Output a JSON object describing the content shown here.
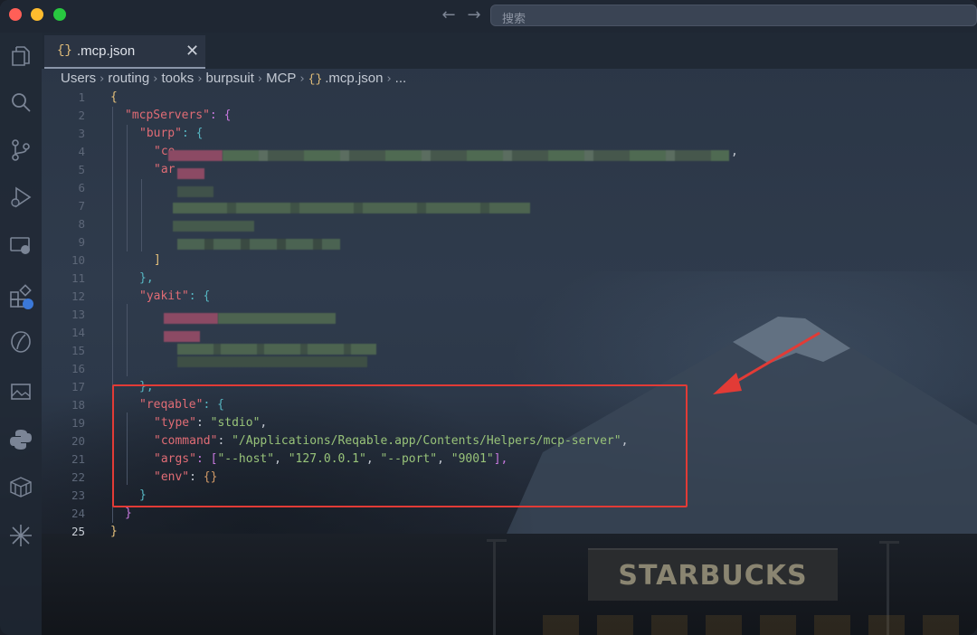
{
  "window": {
    "search_placeholder": "搜索"
  },
  "tab": {
    "braces": "{}",
    "filename": ".mcp.json",
    "close": "✕"
  },
  "breadcrumb": {
    "parts": [
      "Users",
      "routing",
      "tooks",
      "burpsuit",
      "MCP"
    ],
    "file_braces": "{}",
    "file": ".mcp.json",
    "ellipsis": "..."
  },
  "activity_icons": [
    "explorer-icon",
    "search-icon",
    "source-control-icon",
    "run-debug-icon",
    "remote-explorer-icon",
    "extensions-icon",
    "copilot-icon",
    "image-preview-icon",
    "python-icon",
    "docker-icon",
    "sparkle-icon"
  ],
  "line_numbers": [
    "1",
    "2",
    "3",
    "4",
    "5",
    "6",
    "7",
    "8",
    "9",
    "10",
    "11",
    "12",
    "13",
    "14",
    "15",
    "16",
    "17",
    "18",
    "19",
    "20",
    "21",
    "22",
    "23",
    "24",
    "25"
  ],
  "code": {
    "l1": "{",
    "l2_key": "\"mcpServers\"",
    "l2_rest": ": {",
    "l3_key": "\"burp\"",
    "l3_rest": ": {",
    "l4_key": "\"co",
    "l4_comma": ",",
    "l5_key": "\"ar",
    "l10": "]",
    "l11": "},",
    "l12_key": "\"yakit\"",
    "l12_rest": ": {",
    "l17": "},",
    "l18_key": "\"reqable\"",
    "l18_rest": ": {",
    "l19_key": "\"type\"",
    "l19_colon": ": ",
    "l19_val": "\"stdio\"",
    "l19_comma": ",",
    "l20_key": "\"command\"",
    "l20_colon": ": ",
    "l20_val": "\"/Applications/Reqable.app/Contents/Helpers/mcp-server\"",
    "l20_comma": ",",
    "l21_key": "\"args\"",
    "l21_colon": ": [",
    "l21_a1": "\"--host\"",
    "l21_sep1": ", ",
    "l21_a2": "\"127.0.0.1\"",
    "l21_sep2": ", ",
    "l21_a3": "\"--port\"",
    "l21_sep3": ", ",
    "l21_a4": "\"9001\"",
    "l21_end": "],",
    "l22_key": "\"env\"",
    "l22_colon": ": ",
    "l22_val": "{}",
    "l23": "}",
    "l24": "}",
    "l25": "}"
  },
  "background": {
    "store_sign": "STARBUCKS"
  },
  "colors": {
    "highlight": "#e23b36",
    "arrow": "#e23b36"
  }
}
